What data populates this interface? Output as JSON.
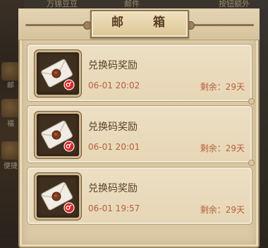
{
  "background": {
    "top_left_text": "万锦豆豆",
    "top_mid_text": "邮件",
    "top_right_text": "按钮额外",
    "side_labels": [
      "邮",
      "福",
      "便捷"
    ]
  },
  "window": {
    "title": "邮 箱"
  },
  "mails": [
    {
      "title": "兑换码奖励",
      "date": "06-01 20:02",
      "remaining": "剩余：29天",
      "icon": "envelope-icon"
    },
    {
      "title": "兑换码奖励",
      "date": "06-01 20:01",
      "remaining": "剩余：29天",
      "icon": "envelope-icon"
    },
    {
      "title": "兑换码奖励",
      "date": "06-01 19:57",
      "remaining": "剩余：29天",
      "icon": "envelope-icon"
    }
  ],
  "colors": {
    "panel": "#dbc9a5",
    "item": "#ecdfc3",
    "title_text": "#5b4228",
    "accent_text": "#b5603f",
    "seal": "#7a3a1e",
    "badge": "#d8262a"
  }
}
